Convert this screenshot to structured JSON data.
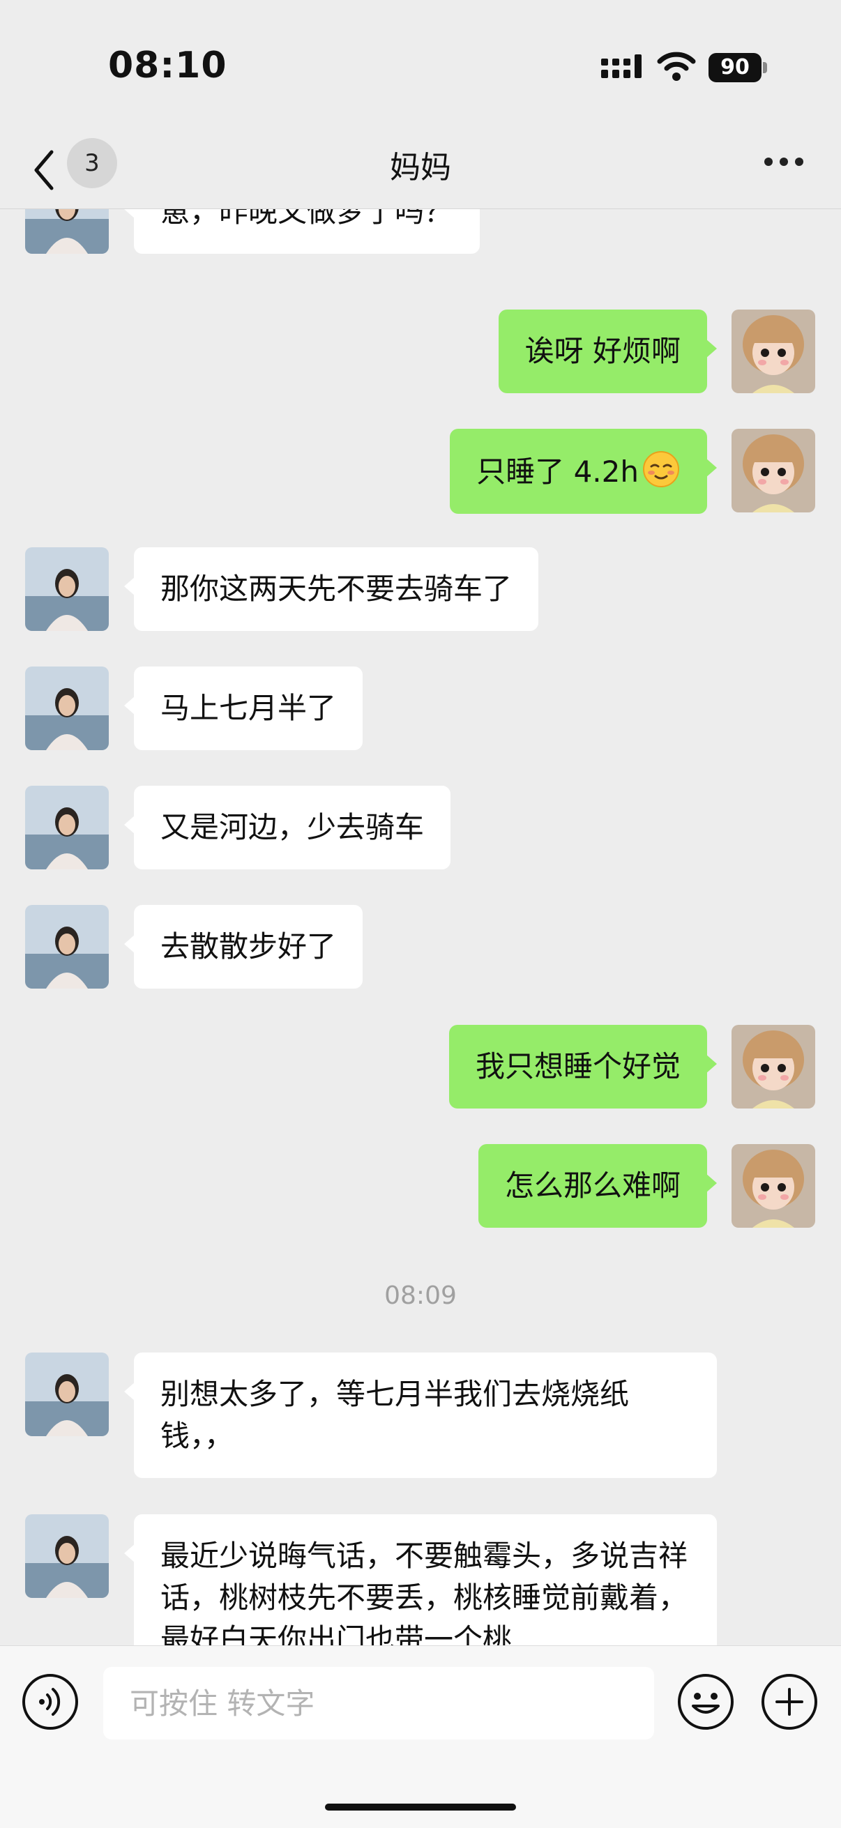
{
  "status_bar": {
    "time": "08:10",
    "battery": "90"
  },
  "nav": {
    "unread_count": "3",
    "title": "妈妈"
  },
  "messages": [
    {
      "from": "mom",
      "text": "崽，昨晚又做梦了吗？"
    },
    {
      "from": "me",
      "text": "诶呀 好烦啊"
    },
    {
      "from": "me",
      "text": "只睡了 4.2h",
      "emoji": "smiling-blush-emoji"
    },
    {
      "from": "mom",
      "text": "那你这两天先不要去骑车了"
    },
    {
      "from": "mom",
      "text": "马上七月半了"
    },
    {
      "from": "mom",
      "text": "又是河边，少去骑车"
    },
    {
      "from": "mom",
      "text": "去散散步好了"
    },
    {
      "from": "me",
      "text": "我只想睡个好觉"
    },
    {
      "from": "me",
      "text": "怎么那么难啊"
    },
    {
      "from": "mom",
      "text": "别想太多了，等七月半我们去烧烧纸钱，，"
    },
    {
      "from": "mom",
      "text": "最近少说晦气话，不要触霉头，多说吉祥话，桃树枝先不要丢，桃核睡觉前戴着，最好白天你出门也带一个桃"
    }
  ],
  "time_divider": "08:09",
  "input": {
    "placeholder": "可按住 转文字"
  },
  "icons": {
    "back": "chevron-left-icon",
    "more": "more-dots-icon",
    "voice": "voice-icon",
    "emoji": "emoji-icon",
    "plus": "plus-icon"
  },
  "colors": {
    "outgoing_bubble": "#95ec69",
    "incoming_bubble": "#ffffff",
    "background": "#ededed"
  }
}
